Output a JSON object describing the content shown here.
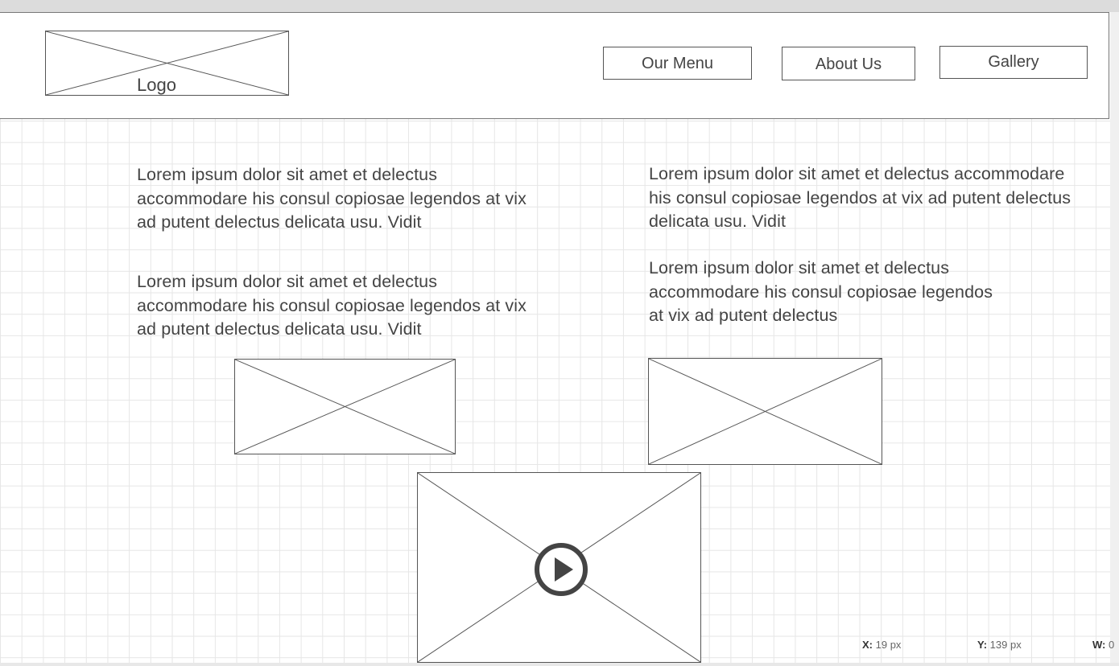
{
  "header": {
    "logo_label": "Logo",
    "nav": [
      {
        "label": "Our Menu"
      },
      {
        "label": "About Us"
      },
      {
        "label": "Gallery"
      }
    ]
  },
  "content": {
    "left_paragraphs": [
      "Lorem ipsum dolor sit amet et delectus accommodare his consul copiosae legendos at vix ad putent delectus delicata usu. Vidit",
      "Lorem ipsum dolor sit amet et delectus accommodare his consul copiosae legendos at vix ad putent delectus delicata usu. Vidit"
    ],
    "right_paragraphs": [
      "Lorem ipsum dolor sit amet et delectus accommodare his consul copiosae legendos at vix ad putent delectus delicata usu. Vidit",
      "Lorem ipsum dolor sit amet et delectus accommodare his consul copiosae legendos at vix ad putent delectus"
    ]
  },
  "status": {
    "x_label": "X:",
    "x_value": "19 px",
    "y_label": "Y:",
    "y_value": "139 px",
    "w_label": "W:",
    "w_value": "0"
  }
}
